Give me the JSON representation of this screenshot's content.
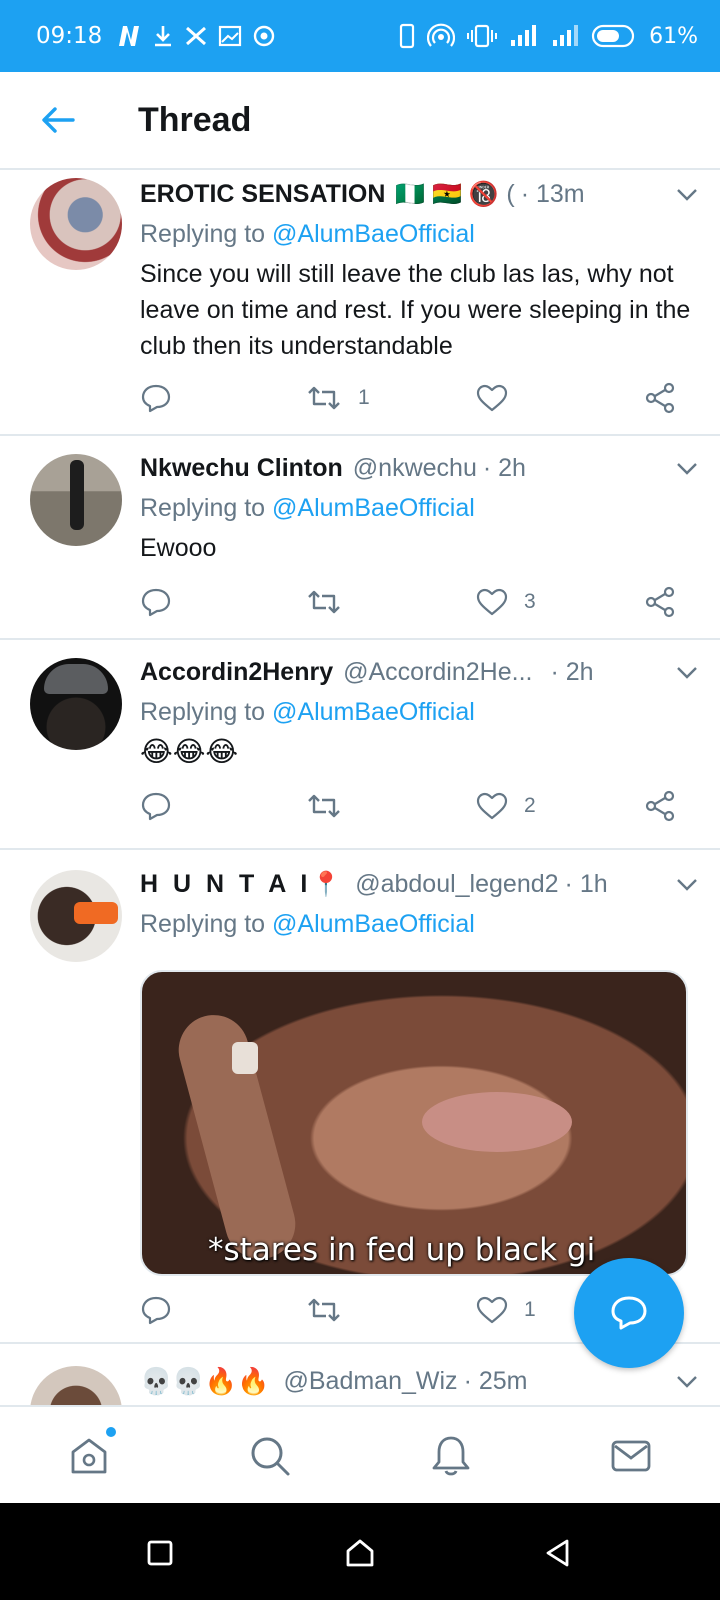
{
  "status_bar": {
    "time": "09:18",
    "battery_percent": "61%",
    "left_icons": [
      "netflix-n-icon",
      "download-icon",
      "x-icon",
      "image-icon",
      "circle-icon"
    ],
    "right_icons": [
      "phone-icon",
      "hotspot-icon",
      "vibrate-icon",
      "signal-icon",
      "signal-icon",
      "battery-icon"
    ]
  },
  "header": {
    "title": "Thread",
    "back_icon": "arrow-left-icon"
  },
  "colors": {
    "accent": "#1da1f2",
    "text_primary": "#14171a",
    "text_secondary": "#657786",
    "divider": "#e1e8ed"
  },
  "tweets": [
    {
      "name": "EROTIC SENSATION",
      "name_emoji": "🇳🇬 🇬🇭 🔞",
      "handle": "(",
      "time": "· 13m",
      "replying_prefix": "Replying to",
      "replying_to": "@AlumBaeOfficial",
      "text": "Since you will still leave the club las las, why not leave on time and rest. If you were sleeping in the club then its understandable",
      "retweets": "1",
      "likes": ""
    },
    {
      "name": "Nkwechu Clinton",
      "handle": "@nkwechu",
      "time": "· 2h",
      "replying_prefix": "Replying to",
      "replying_to": "@AlumBaeOfficial",
      "text": "Ewooo",
      "retweets": "",
      "likes": "3"
    },
    {
      "name": "Accordin2Henry",
      "handle": "@Accordin2He...",
      "time": "· 2h",
      "replying_prefix": "Replying to",
      "replying_to": "@AlumBaeOfficial",
      "text": "😂😂😂",
      "retweets": "",
      "likes": "2"
    },
    {
      "name": "H U N T A I",
      "name_emoji": "📍",
      "handle": "@abdoul_legend2",
      "time": "· 1h",
      "replying_prefix": "Replying to",
      "replying_to": "@AlumBaeOfficial",
      "media_caption": "*stares in fed up black gi",
      "retweets": "",
      "likes": "1"
    },
    {
      "name": "💀💀🔥🔥",
      "handle": "@Badman_Wiz",
      "time": "· 25m"
    }
  ],
  "fab": {
    "icon": "compose-reply-icon"
  },
  "tabbar": {
    "items": [
      "home-icon",
      "search-icon",
      "notifications-icon",
      "messages-icon"
    ]
  },
  "android_nav": [
    "recents-icon",
    "home-icon",
    "back-icon"
  ]
}
